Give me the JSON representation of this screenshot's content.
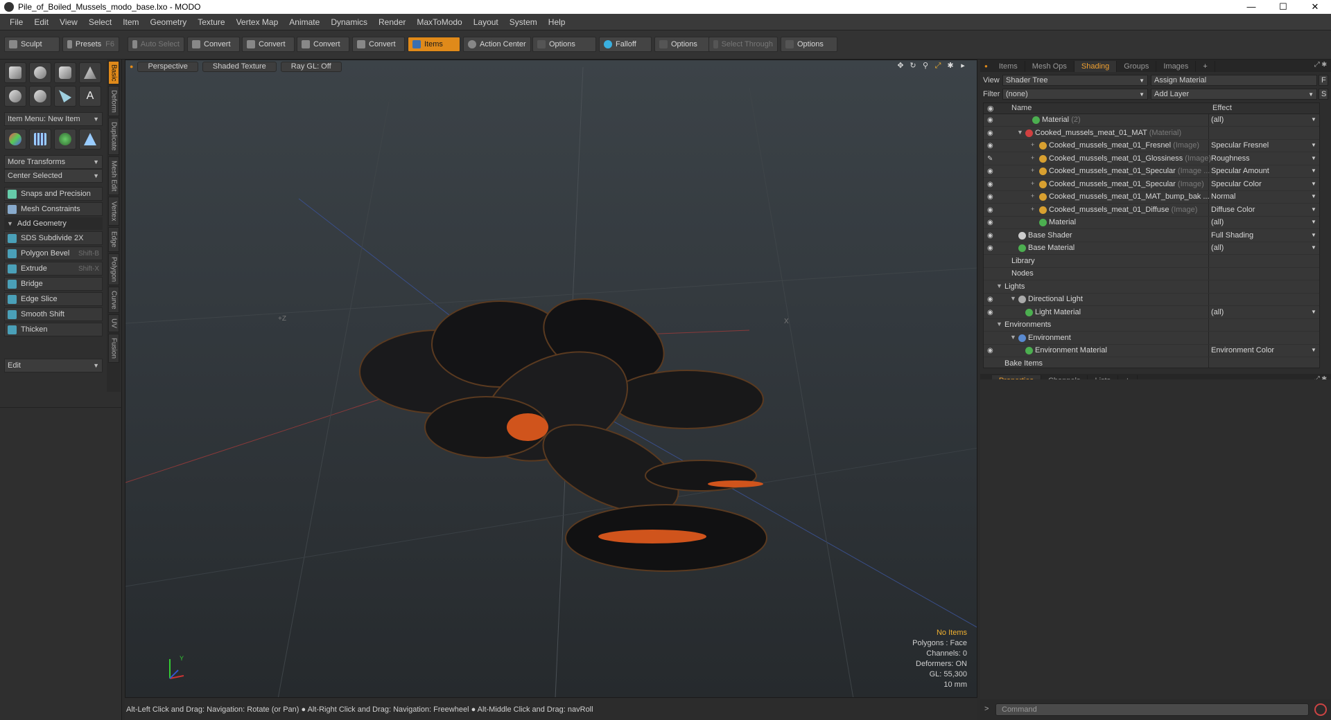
{
  "window": {
    "title": "Pile_of_Boiled_Mussels_modo_base.lxo - MODO"
  },
  "menu": [
    "File",
    "Edit",
    "View",
    "Select",
    "Item",
    "Geometry",
    "Texture",
    "Vertex Map",
    "Animate",
    "Dynamics",
    "Render",
    "MaxToModo",
    "Layout",
    "System",
    "Help"
  ],
  "toolbar": {
    "sculpt": "Sculpt",
    "presets": "Presets",
    "presets_key": "F6",
    "auto_select": "Auto Select",
    "convert": "Convert",
    "items": "Items",
    "action_center": "Action Center",
    "options": "Options",
    "falloff": "Falloff",
    "select_through": "Select Through"
  },
  "left": {
    "item_menu": "Item Menu: New Item",
    "more_transforms": "More Transforms",
    "center_selected": "Center Selected",
    "snaps": "Snaps and Precision",
    "mesh_constraints": "Mesh Constraints",
    "add_geometry": "Add Geometry",
    "tools": [
      {
        "label": "SDS Subdivide 2X",
        "key": ""
      },
      {
        "label": "Polygon Bevel",
        "key": "Shift-B"
      },
      {
        "label": "Extrude",
        "key": "Shift-X"
      },
      {
        "label": "Bridge",
        "key": ""
      },
      {
        "label": "Edge Slice",
        "key": ""
      },
      {
        "label": "Smooth Shift",
        "key": ""
      },
      {
        "label": "Thicken",
        "key": ""
      }
    ],
    "edit": "Edit",
    "vtabs": [
      "Basic",
      "Deform",
      "Duplicate",
      "Mesh Edit",
      "Vertex",
      "Edge",
      "Polygon",
      "Curve",
      "UV",
      "Fusion"
    ]
  },
  "viewport": {
    "perspective": "Perspective",
    "shaded": "Shaded Texture",
    "raygl": "Ray GL: Off",
    "stats": {
      "items": "No Items",
      "polygons": "Polygons : Face",
      "channels": "Channels: 0",
      "deformers": "Deformers: ON",
      "gl": "GL: 55,300",
      "scale": "10 mm"
    },
    "axis_y": "Y",
    "axis_z": "+Z",
    "axis_x": "X"
  },
  "status": "Alt-Left Click and Drag: Navigation: Rotate (or Pan) ● Alt-Right Click and Drag: Navigation: Freewheel ● Alt-Middle Click and Drag: navRoll",
  "right": {
    "tabs": [
      "Items",
      "Mesh Ops",
      "Shading",
      "Groups",
      "Images",
      "+"
    ],
    "view_label": "View",
    "view_value": "Shader Tree",
    "assign": "Assign Material",
    "filter_label": "Filter",
    "filter_value": "(none)",
    "add_layer": "Add Layer",
    "col_name": "Name",
    "col_effect": "Effect",
    "rows": [
      {
        "name": "Material",
        "sub": "(2)",
        "effect": "(all)",
        "indent": 70,
        "color": "#4caf50",
        "eye": "◉",
        "tw": ""
      },
      {
        "name": "Cooked_mussels_meat_01_MAT",
        "sub": "(Material)",
        "effect": "",
        "indent": 60,
        "color": "#d04040",
        "eye": "◉",
        "tw": "▼"
      },
      {
        "name": "Cooked_mussels_meat_01_Fresnel",
        "sub": "(Image)",
        "effect": "Specular Fresnel",
        "indent": 80,
        "color": "#d8a030",
        "eye": "◉",
        "tw": "+"
      },
      {
        "name": "Cooked_mussels_meat_01_Glossiness",
        "sub": "(Image)",
        "effect": "Roughness",
        "indent": 80,
        "color": "#d8a030",
        "eye": "✎",
        "tw": "+"
      },
      {
        "name": "Cooked_mussels_meat_01_Specular",
        "sub": "(Image ...",
        "effect": "Specular Amount",
        "indent": 80,
        "color": "#d8a030",
        "eye": "◉",
        "tw": "+"
      },
      {
        "name": "Cooked_mussels_meat_01_Specular",
        "sub": "(Image)",
        "effect": "Specular Color",
        "indent": 80,
        "color": "#d8a030",
        "eye": "◉",
        "tw": "+"
      },
      {
        "name": "Cooked_mussels_meat_01_MAT_bump_bak ...",
        "sub": "",
        "effect": "Normal",
        "indent": 80,
        "color": "#d8a030",
        "eye": "◉",
        "tw": "+"
      },
      {
        "name": "Cooked_mussels_meat_01_Diffuse",
        "sub": "(Image)",
        "effect": "Diffuse Color",
        "indent": 80,
        "color": "#d8a030",
        "eye": "◉",
        "tw": "+"
      },
      {
        "name": "Material",
        "sub": "",
        "effect": "(all)",
        "indent": 80,
        "color": "#4caf50",
        "eye": "◉",
        "tw": ""
      },
      {
        "name": "Base Shader",
        "sub": "",
        "effect": "Full Shading",
        "indent": 50,
        "color": "#cccccc",
        "eye": "◉",
        "tw": ""
      },
      {
        "name": "Base Material",
        "sub": "",
        "effect": "(all)",
        "indent": 50,
        "color": "#4caf50",
        "eye": "◉",
        "tw": ""
      },
      {
        "name": "Library",
        "sub": "",
        "effect": "",
        "indent": 40,
        "color": "",
        "eye": "",
        "tw": ""
      },
      {
        "name": "Nodes",
        "sub": "",
        "effect": "",
        "indent": 40,
        "color": "",
        "eye": "",
        "tw": ""
      },
      {
        "name": "Lights",
        "sub": "",
        "effect": "",
        "indent": 30,
        "color": "",
        "eye": "",
        "tw": "▼"
      },
      {
        "name": "Directional Light",
        "sub": "",
        "effect": "",
        "indent": 50,
        "color": "#aaaaaa",
        "eye": "◉",
        "tw": "▼"
      },
      {
        "name": "Light Material",
        "sub": "",
        "effect": "(all)",
        "indent": 60,
        "color": "#4caf50",
        "eye": "◉",
        "tw": ""
      },
      {
        "name": "Environments",
        "sub": "",
        "effect": "",
        "indent": 30,
        "color": "",
        "eye": "",
        "tw": "▼"
      },
      {
        "name": "Environment",
        "sub": "",
        "effect": "",
        "indent": 50,
        "color": "#5a8ad0",
        "eye": "",
        "tw": "▼"
      },
      {
        "name": "Environment Material",
        "sub": "",
        "effect": "Environment Color",
        "indent": 60,
        "color": "#4caf50",
        "eye": "◉",
        "tw": ""
      },
      {
        "name": "Bake Items",
        "sub": "",
        "effect": "",
        "indent": 30,
        "color": "",
        "eye": "",
        "tw": ""
      }
    ],
    "prop_tabs": [
      "Properties",
      "Channels",
      "Lists",
      "+"
    ],
    "command": "Command"
  }
}
